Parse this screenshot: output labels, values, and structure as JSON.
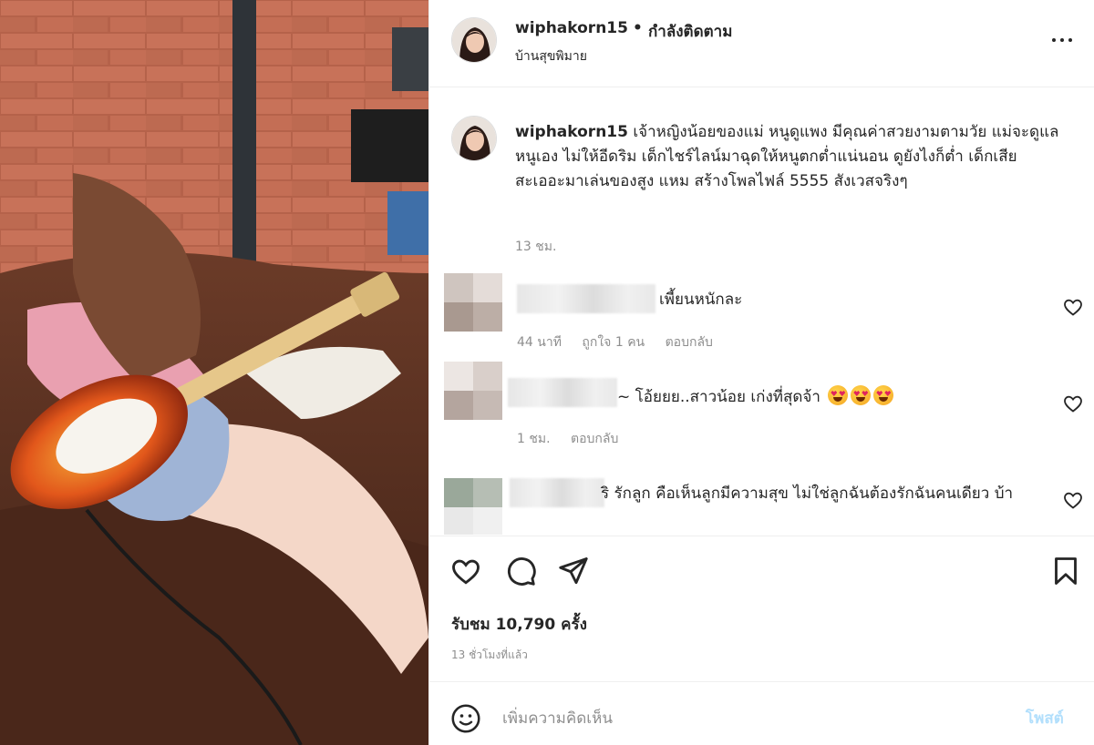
{
  "post_header": {
    "username": "wiphakorn15",
    "dot": "•",
    "follow_status": "กำลังติดตาม",
    "location": "บ้านสุขพิมาย"
  },
  "caption": {
    "username": "wiphakorn15",
    "text": "เจ้าหญิงน้อยของแม่ หนูดูแพง มีคุณค่าสวยงามตามวัย แม่จะดูแลหนูเอง ไม่ให้อีดริม เด็กไชร์ไลน์มาฉุดให้หนูตกต่ำแน่นอน ดูยังไงก็ต่ำ เด็กเสีย สะเออะมาเล่นของสูง แหม สร้างโพลไฟล์ 5555 สังเวสจริงๆ",
    "time": "13 ชม."
  },
  "comments": [
    {
      "text": "เพี้ยนหนักละ",
      "time": "44 นาที",
      "likes": "ถูกใจ 1 คน",
      "reply": "ตอบกลับ"
    },
    {
      "text": "~ โอ้ยยย..สาวน้อย เก่งที่สุดจ้า",
      "time": "1 ชม.",
      "reply": "ตอบกลับ"
    },
    {
      "text": "ริ รักลูก คือเห็นลูกมีความสุข ไม่ใช่ลูกฉันต้องรักฉันคนเดียว บ้า"
    }
  ],
  "stats": {
    "views": "รับชม 10,790 ครั้ง",
    "time_ago": "13 ชั่วโมงที่แล้ว"
  },
  "comment_box": {
    "placeholder": "เพิ่มความคิดเห็น",
    "post_label": "โพสต์"
  },
  "icons": {
    "more": "more-icon",
    "like": "heart-icon",
    "comment": "comment-icon",
    "share": "send-icon",
    "save": "bookmark-icon",
    "emoji": "smiley-icon"
  },
  "colors": {
    "text": "#262626",
    "muted": "#8e8e8e",
    "post_button": "#b2dffc",
    "border": "#efefef"
  }
}
